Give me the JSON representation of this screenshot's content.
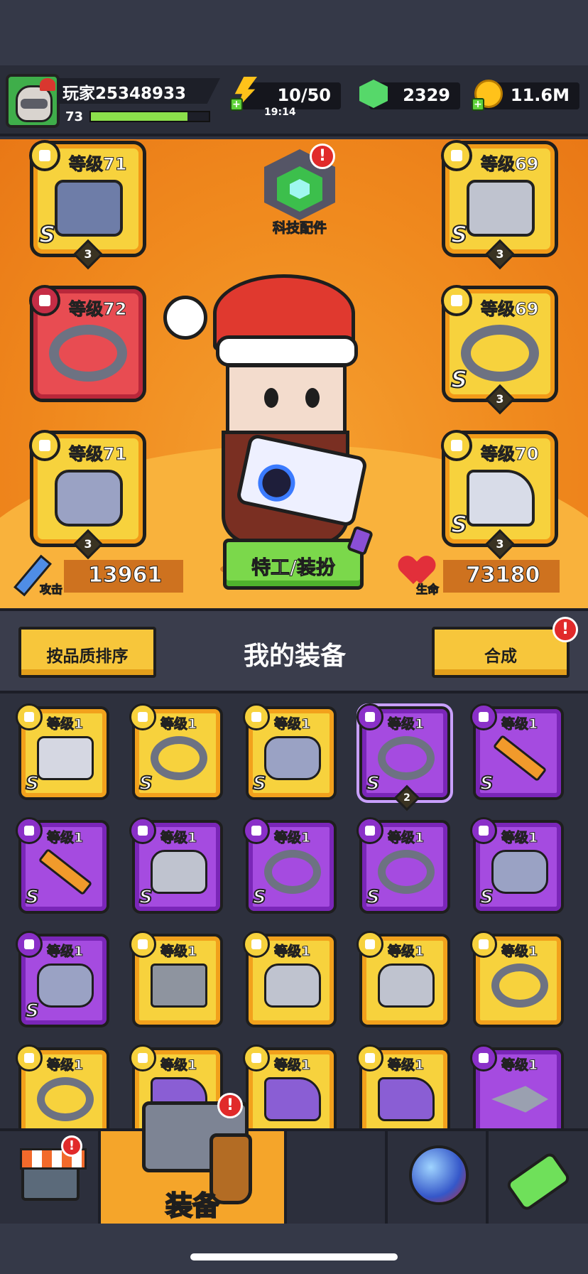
{
  "player": {
    "name": "玩家25348933",
    "level": "73",
    "xp_fraction": 0.82
  },
  "resources": {
    "energy": "10/50",
    "energy_timer": "19:14",
    "gems": "2329",
    "coins": "11.6M"
  },
  "tech": {
    "label": "科技配件",
    "alert": "!"
  },
  "equipped": [
    {
      "level": "等级71",
      "rank": "S",
      "stars": "3",
      "icon": "blaster-icon"
    },
    {
      "level": "等级72",
      "rank": "",
      "stars": "",
      "icon": "spiked-collar-icon"
    },
    {
      "level": "等级71",
      "rank": "",
      "stars": "3",
      "icon": "gauntlet-icon"
    },
    {
      "level": "等级69",
      "rank": "S",
      "stars": "3",
      "icon": "armor-icon"
    },
    {
      "level": "等级69",
      "rank": "S",
      "stars": "3",
      "icon": "belt-icon"
    },
    {
      "level": "等级70",
      "rank": "S",
      "stars": "3",
      "icon": "boot-icon"
    }
  ],
  "costume_button": "特工/装扮",
  "stats": {
    "attack_label": "攻击",
    "attack": "13961",
    "hp_label": "生命",
    "hp": "73180"
  },
  "equip_header": {
    "sort_button": "按品质排序",
    "title": "我的装备",
    "merge_button": "合成",
    "merge_alert": "!"
  },
  "inventory": [
    {
      "level": "等级1",
      "rank": "S",
      "stars": "",
      "quality": "legendary",
      "icon": "blaster-icon"
    },
    {
      "level": "等级1",
      "rank": "S",
      "stars": "",
      "quality": "legendary",
      "icon": "belt-icon"
    },
    {
      "level": "等级1",
      "rank": "S",
      "stars": "",
      "quality": "legendary",
      "icon": "gauntlet-icon"
    },
    {
      "level": "等级1",
      "rank": "S",
      "stars": "2",
      "quality": "epic",
      "icon": "belt-icon"
    },
    {
      "level": "等级1",
      "rank": "S",
      "stars": "",
      "quality": "epic",
      "icon": "blade-icon"
    },
    {
      "level": "等级1",
      "rank": "S",
      "stars": "",
      "quality": "epic",
      "icon": "blade-icon"
    },
    {
      "level": "等级1",
      "rank": "S",
      "stars": "",
      "quality": "epic",
      "icon": "armor-icon"
    },
    {
      "level": "等级1",
      "rank": "S",
      "stars": "",
      "quality": "epic",
      "icon": "ring-icon"
    },
    {
      "level": "等级1",
      "rank": "S",
      "stars": "",
      "quality": "epic",
      "icon": "ring-icon"
    },
    {
      "level": "等级1",
      "rank": "S",
      "stars": "",
      "quality": "epic",
      "icon": "gauntlet-icon"
    },
    {
      "level": "等级1",
      "rank": "S",
      "stars": "",
      "quality": "epic",
      "icon": "gauntlet-icon"
    },
    {
      "level": "等级1",
      "rank": "",
      "stars": "",
      "quality": "legendary",
      "icon": "revolver-icon"
    },
    {
      "level": "等级1",
      "rank": "",
      "stars": "",
      "quality": "legendary",
      "icon": "vest-icon"
    },
    {
      "level": "等级1",
      "rank": "",
      "stars": "",
      "quality": "legendary",
      "icon": "vest-icon"
    },
    {
      "level": "等级1",
      "rank": "",
      "stars": "",
      "quality": "legendary",
      "icon": "spiked-collar-icon"
    },
    {
      "level": "等级1",
      "rank": "",
      "stars": "",
      "quality": "legendary",
      "icon": "star-belt-icon"
    },
    {
      "level": "等级1",
      "rank": "",
      "stars": "",
      "quality": "legendary",
      "icon": "sneaker-icon"
    },
    {
      "level": "等级1",
      "rank": "",
      "stars": "",
      "quality": "legendary",
      "icon": "sneaker-icon"
    },
    {
      "level": "等级1",
      "rank": "",
      "stars": "",
      "quality": "legendary",
      "icon": "sneaker-icon"
    },
    {
      "level": "等级1",
      "rank": "",
      "stars": "",
      "quality": "epic",
      "icon": "kunai-icon"
    }
  ],
  "nav": {
    "shop_icon": "shop-icon",
    "equip_label": "装备",
    "equip_alert": "!",
    "shop_alert": "!",
    "hero_icon": "star-swords-icon",
    "orb_icon": "orb-icon",
    "dna_icon": "dna-tube-icon"
  }
}
